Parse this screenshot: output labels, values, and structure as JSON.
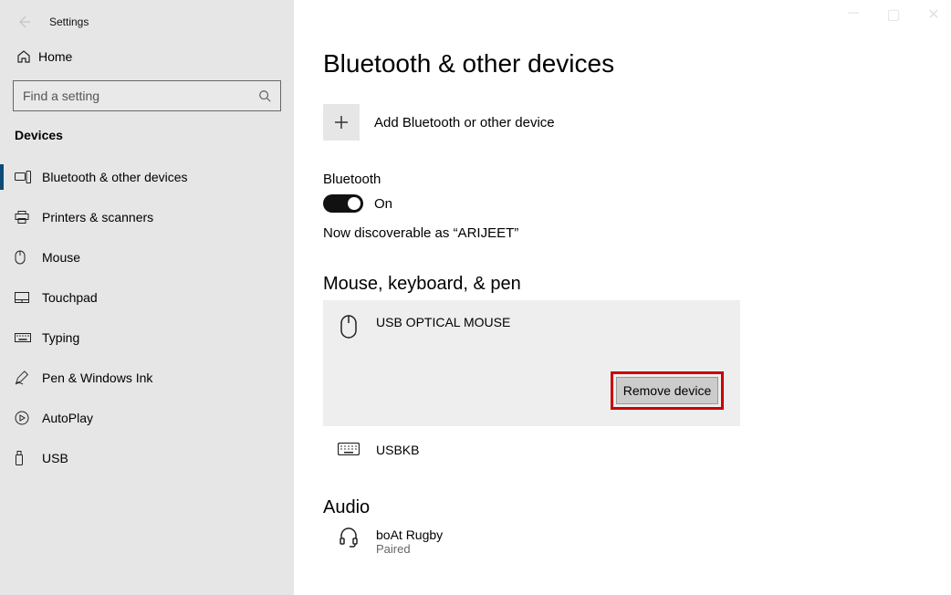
{
  "app": {
    "title": "Settings"
  },
  "sidebar": {
    "home": "Home",
    "search_placeholder": "Find a setting",
    "category": "Devices",
    "items": [
      {
        "label": "Bluetooth & other devices",
        "selected": true
      },
      {
        "label": "Printers & scanners"
      },
      {
        "label": "Mouse"
      },
      {
        "label": "Touchpad"
      },
      {
        "label": "Typing"
      },
      {
        "label": "Pen & Windows Ink"
      },
      {
        "label": "AutoPlay"
      },
      {
        "label": "USB"
      }
    ]
  },
  "main": {
    "title": "Bluetooth & other devices",
    "add_label": "Add Bluetooth or other device",
    "bt_label": "Bluetooth",
    "bt_state": "On",
    "discoverable": "Now discoverable as “ARIJEET”",
    "section1": "Mouse, keyboard, & pen",
    "device1": {
      "name": "USB OPTICAL MOUSE",
      "remove": "Remove device"
    },
    "device2": {
      "name": "USBKB"
    },
    "section2": "Audio",
    "device3": {
      "name": "boAt Rugby",
      "status": "Paired"
    }
  }
}
